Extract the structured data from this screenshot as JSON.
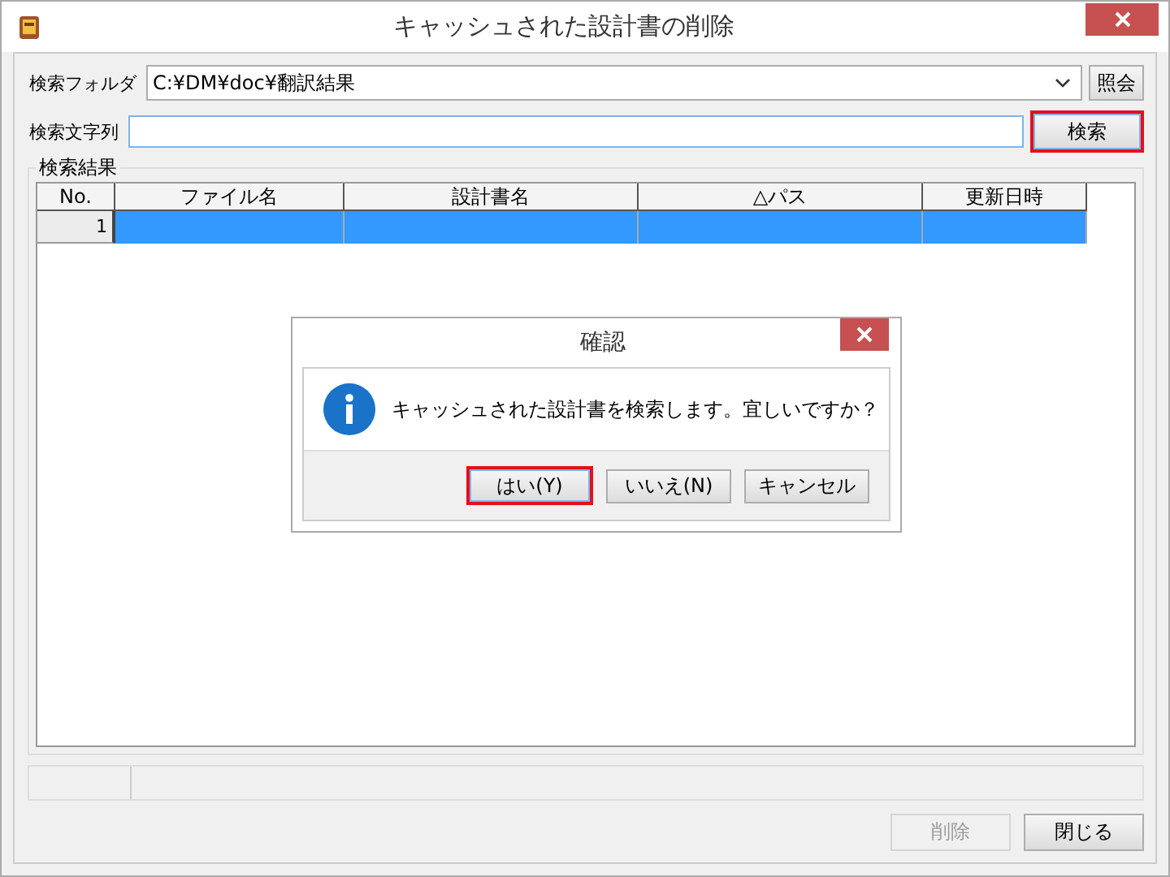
{
  "window": {
    "title": "キャッシュされた設計書の削除"
  },
  "folder": {
    "label": "検索フォルダ",
    "value": "C:¥DM¥doc¥翻訳結果",
    "browse_button": "照会"
  },
  "search": {
    "label": "検索文字列",
    "button": "検索",
    "button_focused": true
  },
  "results": {
    "label": "検索結果",
    "columns": [
      {
        "label": "No."
      },
      {
        "label": "ファイル名"
      },
      {
        "label": "設計書名"
      },
      {
        "label": "△パス"
      },
      {
        "label": "更新日時"
      }
    ],
    "rows": [
      {
        "no": "1",
        "selected": true
      }
    ]
  },
  "buttons": [
    {
      "label": "削除",
      "disabled": true
    },
    {
      "label": "閉じる",
      "disabled": false
    }
  ],
  "dialog": {
    "title": "確認",
    "message": "キャッシュされた設計書を検索します。宜しいですか？",
    "buttons": [
      {
        "label": "はい(Y)",
        "focused": true
      },
      {
        "label": "いいえ(N)",
        "focused": false
      },
      {
        "label": "キャンセル",
        "focused": false
      }
    ]
  }
}
